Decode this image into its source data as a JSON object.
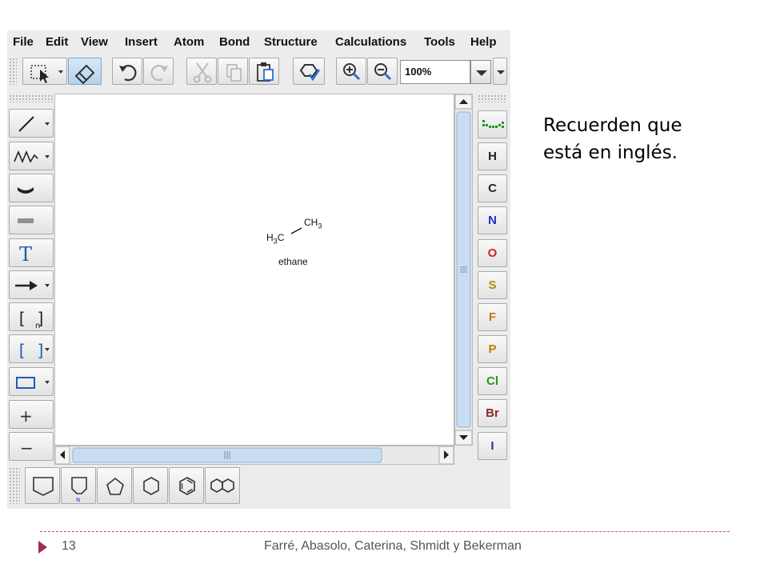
{
  "menu": [
    "File",
    "Edit",
    "View",
    "Insert",
    "Atom",
    "Bond",
    "Structure",
    "Calculations",
    "Tools",
    "Help"
  ],
  "toolbar": {
    "zoom_value": "100%",
    "icons": [
      "select-icon",
      "eraser-icon",
      "undo-icon",
      "redo-icon",
      "cut-icon",
      "copy-icon",
      "paste-icon",
      "clean-structure-icon",
      "zoom-in-icon",
      "zoom-out-icon"
    ]
  },
  "left_tools": {
    "icons": [
      "single-bond-icon",
      "chain-icon",
      "wedge-bond-icon",
      "hashed-bond-icon",
      "text-icon",
      "arrow-icon",
      "bracket-n-icon",
      "bracket-icon",
      "rectangle-icon",
      "plus-icon",
      "minus-icon"
    ],
    "text_glyph": "T",
    "plus_glyph": "+",
    "minus_glyph": "−",
    "bracket_glyph": "[ ]",
    "bracket_sub": "n"
  },
  "elements": [
    {
      "symbol": "H",
      "color": "#222222"
    },
    {
      "symbol": "C",
      "color": "#222222"
    },
    {
      "symbol": "N",
      "color": "#2a2ac8"
    },
    {
      "symbol": "O",
      "color": "#d62020"
    },
    {
      "symbol": "S",
      "color": "#a88c00"
    },
    {
      "symbol": "F",
      "color": "#c87800"
    },
    {
      "symbol": "P",
      "color": "#c87800"
    },
    {
      "symbol": "Cl",
      "color": "#1f9a1f"
    },
    {
      "symbol": "Br",
      "color": "#8b2a1f"
    },
    {
      "symbol": "I",
      "color": "#5b1a9b"
    }
  ],
  "rings": [
    "cyclohexane-chair-icon",
    "pyridine-icon",
    "cyclopentane-icon",
    "cyclohexane-icon",
    "benzene-icon",
    "naphthalene-icon"
  ],
  "ring_n_label": "N",
  "molecule": {
    "left_atom": {
      "main": "H",
      "sub": "3",
      "tail": "C"
    },
    "right_atom": {
      "main": "CH",
      "sub": "3"
    },
    "name": "ethane"
  },
  "note": {
    "line1": "Recuerden que",
    "line2": "está en inglés."
  },
  "footer": {
    "page": "13",
    "authors": "Farré, Abasolo, Caterina, Shmidt y Bekerman"
  },
  "colors": {
    "accent": "#9b2d57",
    "scroll_thumb": "#b9d3ef"
  }
}
